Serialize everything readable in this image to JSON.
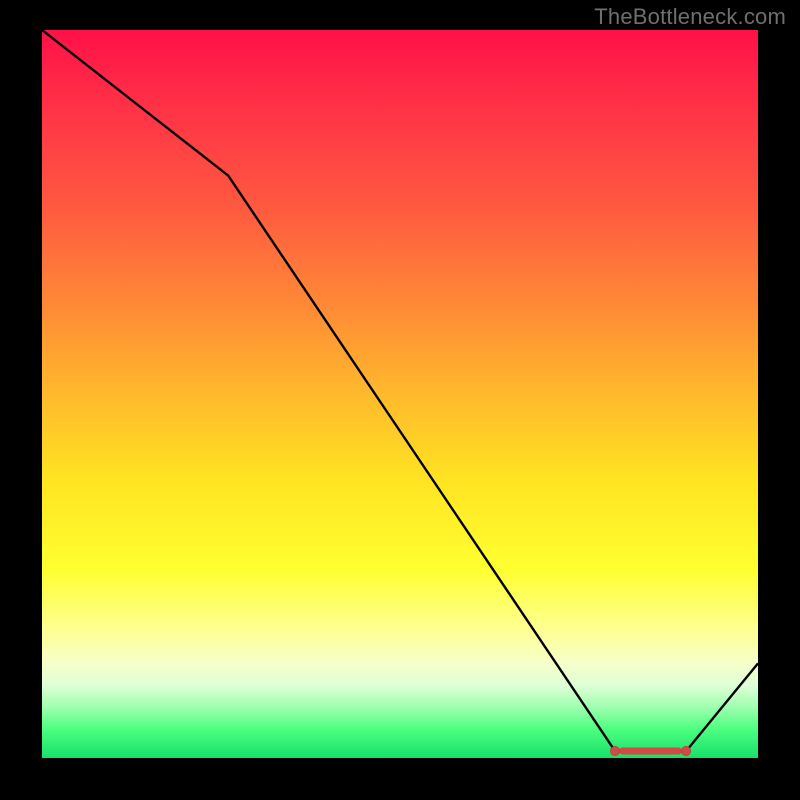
{
  "attribution": "TheBottleneck.com",
  "chart_data": {
    "type": "line",
    "title": "",
    "xlabel": "",
    "ylabel": "",
    "xlim": [
      0,
      100
    ],
    "ylim": [
      0,
      100
    ],
    "x": [
      0,
      26,
      80,
      90,
      100
    ],
    "values": [
      100,
      80,
      1,
      1,
      13
    ],
    "optimal_range": {
      "start": 80,
      "end": 90,
      "level": 1
    },
    "annotations": []
  },
  "colors": {
    "curve": "#000000",
    "markers": "#d24a46",
    "background_frame": "#000000"
  }
}
